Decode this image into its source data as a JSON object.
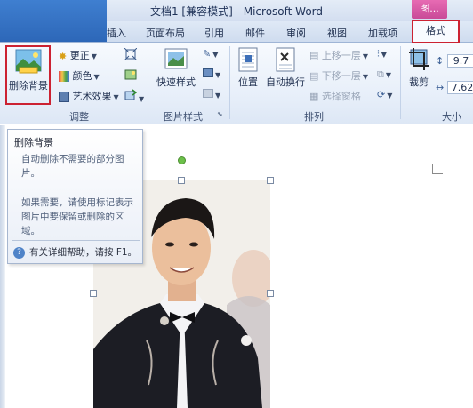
{
  "window": {
    "title": "文档1 [兼容模式] - Microsoft Word",
    "context_tab_group": "图..."
  },
  "tabs": [
    {
      "label": "插入"
    },
    {
      "label": "页面布局"
    },
    {
      "label": "引用"
    },
    {
      "label": "邮件"
    },
    {
      "label": "审阅"
    },
    {
      "label": "视图"
    },
    {
      "label": "加载项"
    },
    {
      "label": "格式",
      "active": true
    }
  ],
  "ribbon": {
    "adjust": {
      "group_label": "调整",
      "remove_background": "删除背景",
      "corrections": "更正",
      "color": "颜色",
      "artistic_effects": "艺术效果"
    },
    "picture_styles": {
      "group_label": "图片样式",
      "quick_styles": "快速样式"
    },
    "arrange": {
      "group_label": "排列",
      "position": "位置",
      "wrap_text": "自动换行",
      "bring_forward": "上移一层",
      "send_backward": "下移一层",
      "selection_pane": "选择窗格"
    },
    "size": {
      "group_label": "大小",
      "crop": "裁剪",
      "height_value": "9.7",
      "width_value": "7.62"
    }
  },
  "tooltip": {
    "title": "删除背景",
    "description": "自动删除不需要的部分图片。",
    "detail": "如果需要，请使用标记表示图片中要保留或删除的区域。",
    "help": "有关详细帮助，请按 F1。"
  },
  "colors": {
    "highlight_border": "#cc2232",
    "ribbon_bg": "#e6eef9",
    "context_tab": "#d35aa5",
    "rotation_handle": "#6cc04a"
  }
}
